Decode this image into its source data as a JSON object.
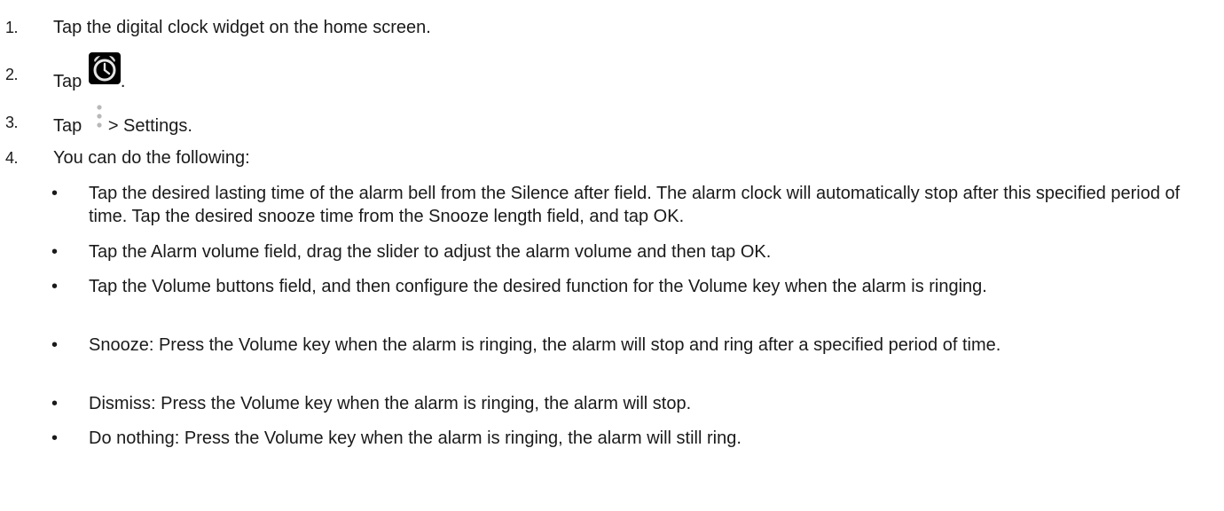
{
  "steps": [
    {
      "num": "1.",
      "text": "Tap the digital clock widget on the home screen."
    },
    {
      "num": "2.",
      "pre": "Tap",
      "post": "."
    },
    {
      "num": "3.",
      "pre": "Tap",
      "post": "> Settings."
    },
    {
      "num": "4.",
      "text": "You can do the following:"
    }
  ],
  "icons": {
    "alarm": "alarm-clock-icon",
    "menu": "overflow-menu-icon"
  },
  "bullets": [
    {
      "symbol": "•",
      "text": "Tap the desired lasting time of the alarm bell from the Silence after field. The alarm clock will automatically stop after this specified period of time. Tap the desired snooze time from the Snooze length field, and tap OK."
    },
    {
      "symbol": "•",
      "text": "Tap the Alarm volume field, drag the slider to adjust the alarm volume and then tap OK."
    },
    {
      "symbol": "•",
      "text": "Tap the Volume buttons field, and then configure the desired function for the Volume key when the alarm is ringing."
    },
    {
      "symbol": "•",
      "text": "Snooze: Press the Volume key when the alarm is ringing, the alarm will stop and ring after a specified period of time."
    },
    {
      "symbol": "•",
      "text": "Dismiss: Press the Volume key when the alarm is ringing, the alarm will stop."
    },
    {
      "symbol": "•",
      "text": "Do nothing: Press the Volume key when the alarm is ringing, the alarm will still ring."
    }
  ]
}
